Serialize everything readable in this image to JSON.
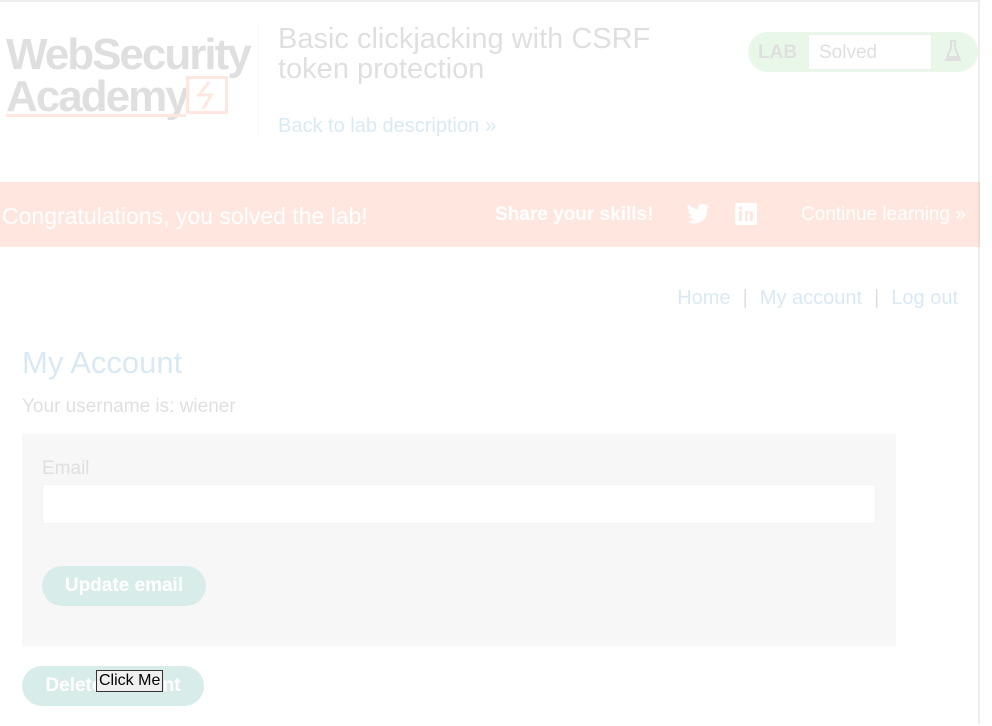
{
  "logo": {
    "line1": "WebSecurity",
    "line2": "Academy"
  },
  "lab": {
    "title": "Basic clickjacking with CSRF token protection",
    "back_link": "Back to lab description",
    "status_label": "LAB",
    "status_value": "Solved"
  },
  "banner": {
    "message": "Congratulations, you solved the lab!",
    "share": "Share your skills!",
    "continue": "Continue learning"
  },
  "nav": {
    "home": "Home",
    "my_account": "My account",
    "log_out": "Log out",
    "separator": "|"
  },
  "account": {
    "title": "My Account",
    "username_line": "Your username is: wiener",
    "email_label": "Email",
    "update_button": "Update email",
    "delete_button": "Delete account"
  },
  "decoy": {
    "label": "Click Me"
  },
  "colors": {
    "accent_orange": "#ff6633",
    "button_teal": "#008c76",
    "link_blue": "#0071bc",
    "status_green": "#70d16d"
  }
}
